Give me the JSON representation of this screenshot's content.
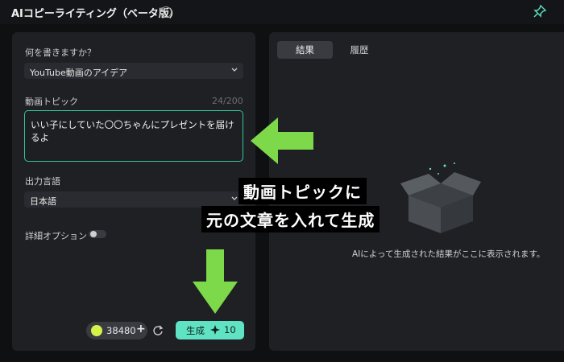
{
  "title": "AIコピーライティング（ベータ版）",
  "left": {
    "q_label": "何を書きますか？",
    "type_select": "YouTube動画のアイデア",
    "topic_label": "動画トピック",
    "counter": "24/200",
    "topic_value": "いい子にしていた〇〇ちゃんにプレゼントを届けるよ",
    "lang_label": "出力言語",
    "lang_select": "日本語",
    "detail_label": "詳細オプション",
    "credits": "38480",
    "generate_label": "生成",
    "generate_cost": "10"
  },
  "right": {
    "tabs": [
      "結果",
      "履歴"
    ],
    "empty_message": "AIによって生成された結果がここに表示されます。"
  },
  "overlay": {
    "line1": "動画トピックに",
    "line2": "元の文章を入れて生成"
  },
  "colors": {
    "accent": "#5fe3c2",
    "arrow": "#7dd94a",
    "border_focus": "#2ec79a"
  }
}
